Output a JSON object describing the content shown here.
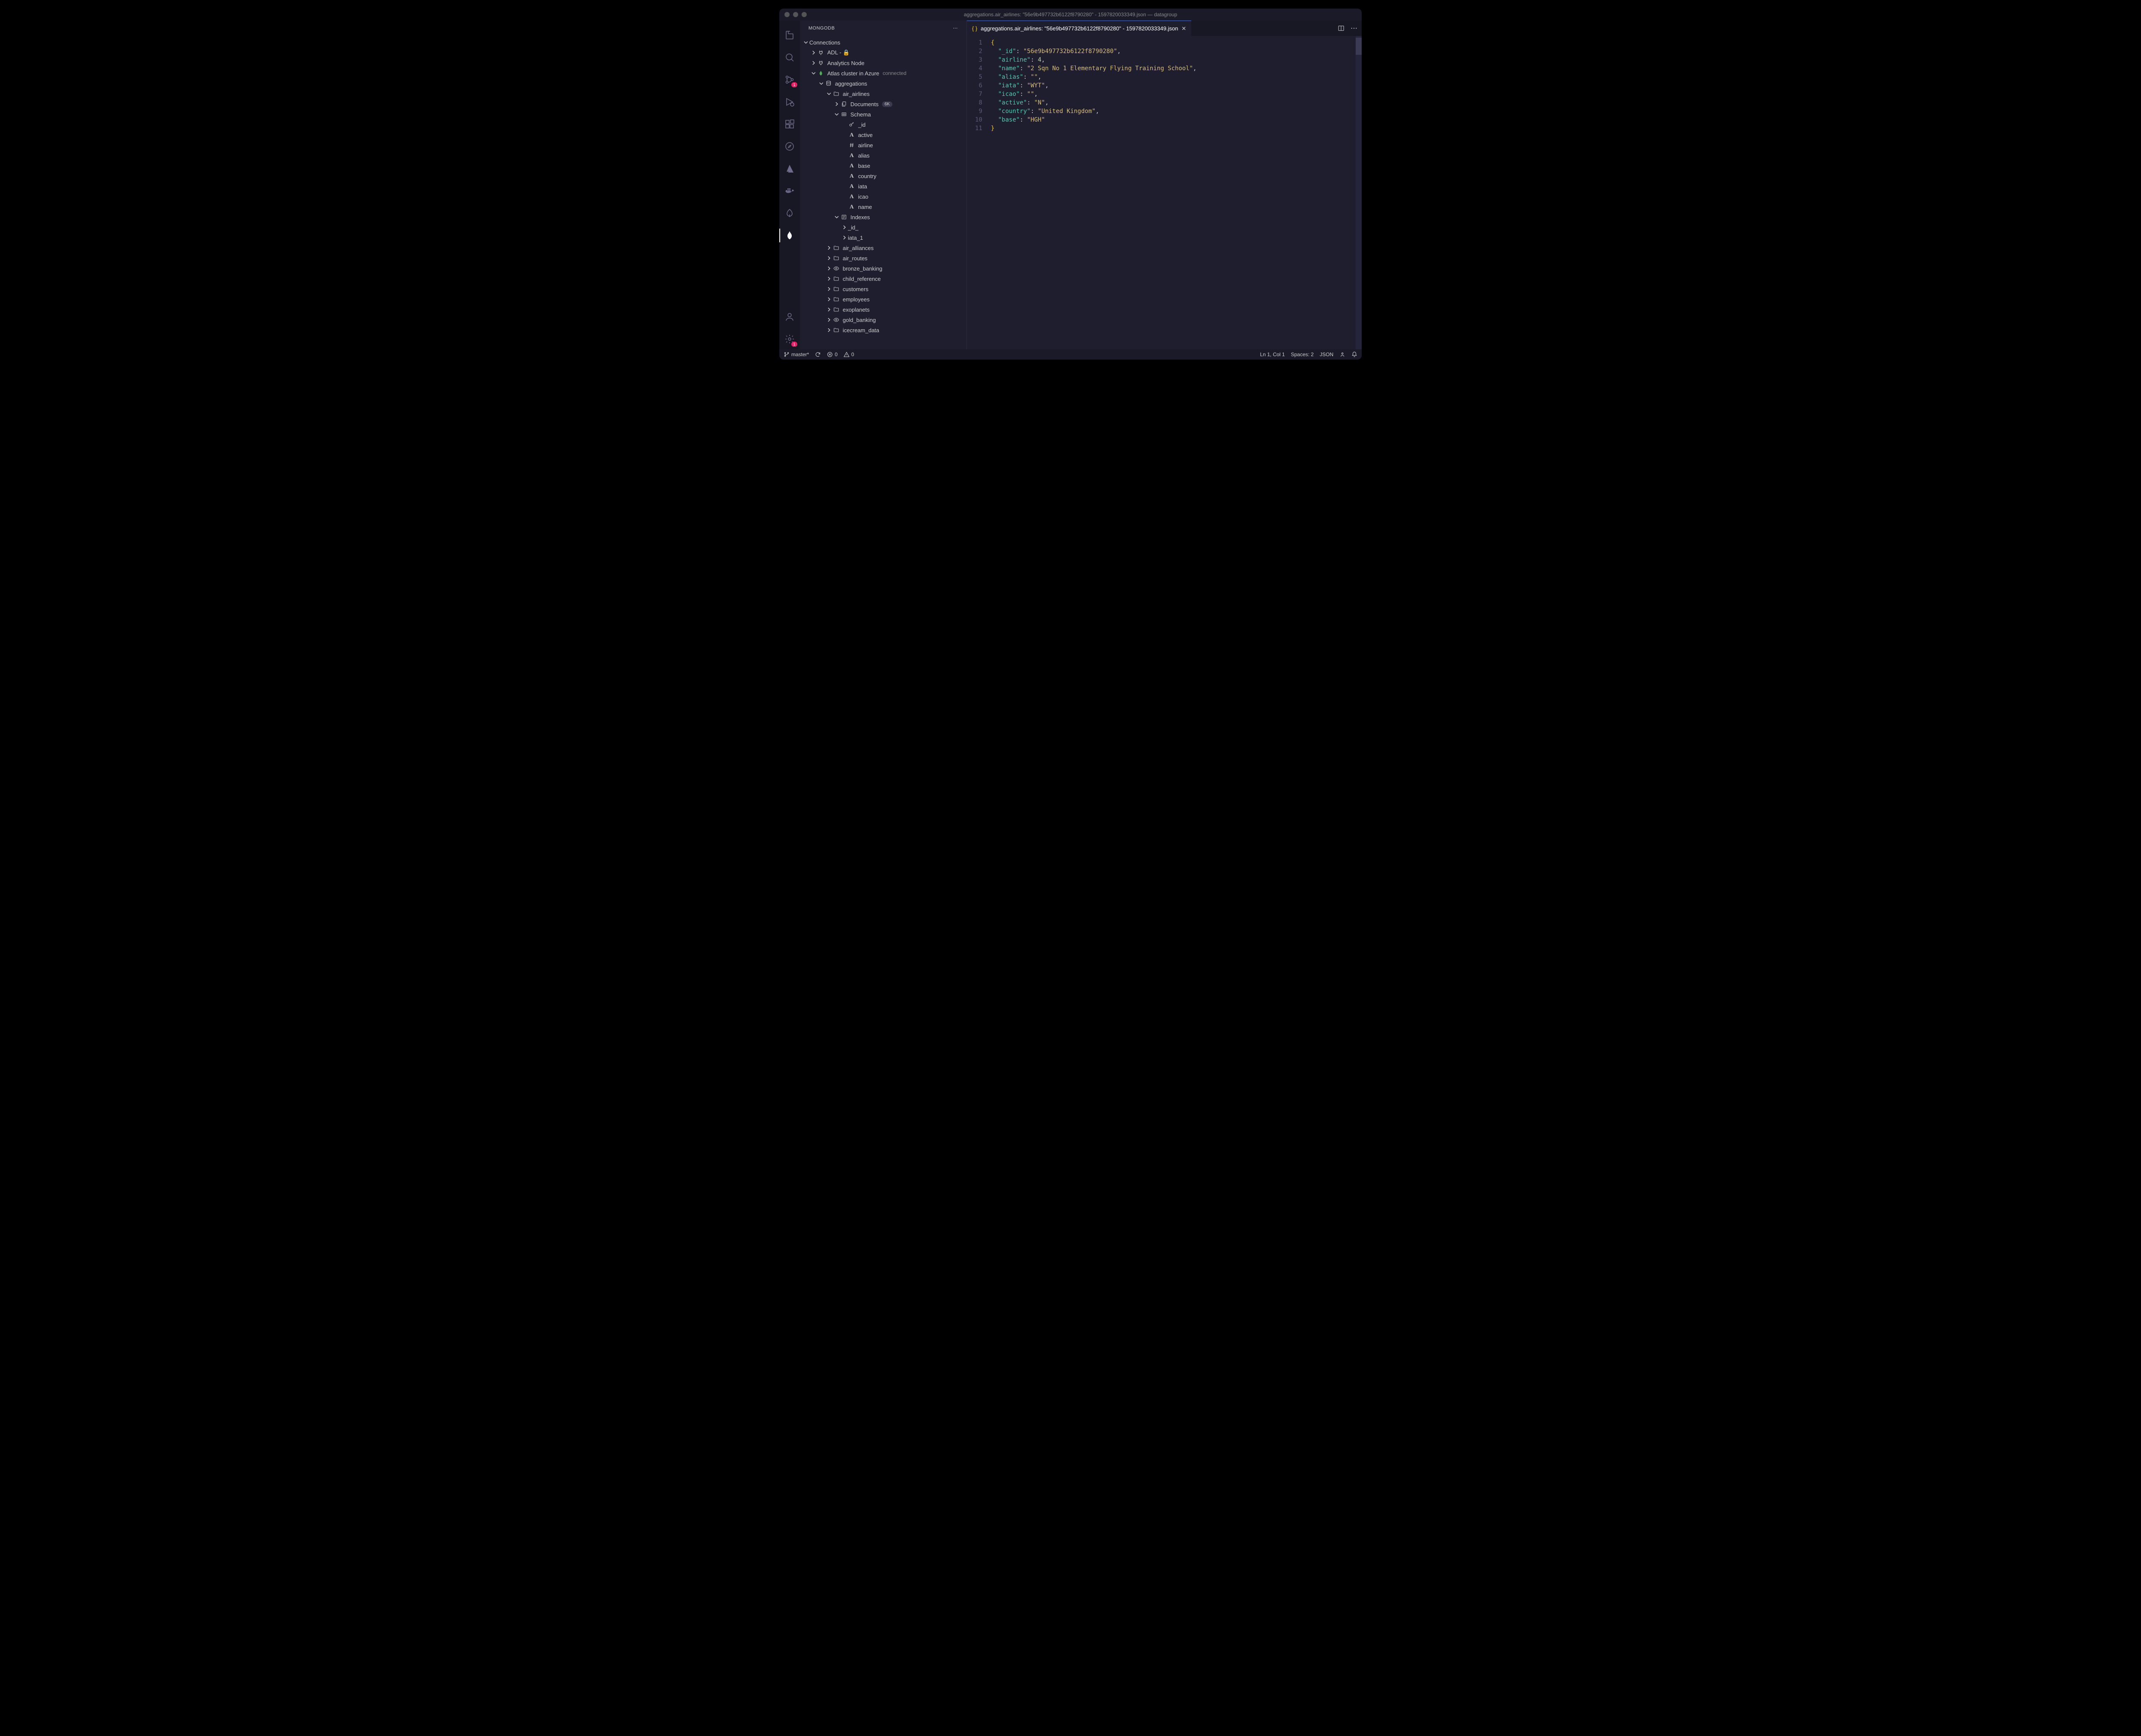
{
  "title": "aggregations.air_airlines: \"56e9b497732b6122f8790280\" - 1597820033349.json — datagroup",
  "sidebar": {
    "title": "MONGODB",
    "sections": {
      "connections": {
        "label": "Connections",
        "items": [
          {
            "label": "ADL - 🔒",
            "icon": "plug"
          },
          {
            "label": "Analytics Node",
            "icon": "plug"
          }
        ],
        "open_conn": {
          "label": "Atlas cluster in Azure",
          "status": "connected",
          "icon": "leaf"
        },
        "db": {
          "label": "aggregations",
          "icon": "database"
        },
        "coll": {
          "label": "air_airlines",
          "icon": "folder"
        },
        "documents": {
          "label": "Documents",
          "count": "6K",
          "icon": "stack"
        },
        "schema": {
          "label": "Schema",
          "icon": "grid"
        },
        "fields": [
          {
            "label": "_id",
            "icon": "key"
          },
          {
            "label": "active",
            "icon": "A"
          },
          {
            "label": "airline",
            "icon": "hash"
          },
          {
            "label": "alias",
            "icon": "A"
          },
          {
            "label": "base",
            "icon": "A"
          },
          {
            "label": "country",
            "icon": "A"
          },
          {
            "label": "iata",
            "icon": "A"
          },
          {
            "label": "icao",
            "icon": "A"
          },
          {
            "label": "name",
            "icon": "A"
          }
        ],
        "indexes": {
          "label": "Indexes",
          "icon": "index",
          "items": [
            "_id_",
            "iata_1"
          ]
        },
        "collections": [
          {
            "label": "air_alliances",
            "icon": "folder"
          },
          {
            "label": "air_routes",
            "icon": "folder"
          },
          {
            "label": "bronze_banking",
            "icon": "eye"
          },
          {
            "label": "child_reference",
            "icon": "folder"
          },
          {
            "label": "customers",
            "icon": "folder"
          },
          {
            "label": "employees",
            "icon": "folder"
          },
          {
            "label": "exoplanets",
            "icon": "folder"
          },
          {
            "label": "gold_banking",
            "icon": "eye"
          },
          {
            "label": "icecream_data",
            "icon": "folder"
          }
        ]
      }
    }
  },
  "tab": {
    "label": "aggregations.air_airlines: \"56e9b497732b6122f8790280\" - 1597820033349.json"
  },
  "document": {
    "_id": "56e9b497732b6122f8790280",
    "airline": 4,
    "name": "2 Sqn No 1 Elementary Flying Training School",
    "alias": "",
    "iata": "WYT",
    "icao": "",
    "active": "N",
    "country": "United Kingdom",
    "base": "HGH"
  },
  "status": {
    "branch": "master*",
    "errors": "0",
    "warnings": "0",
    "cursor": "Ln 1, Col 1",
    "spaces": "Spaces: 2",
    "lang": "JSON"
  },
  "badges": {
    "scm": "1",
    "settings": "1"
  }
}
